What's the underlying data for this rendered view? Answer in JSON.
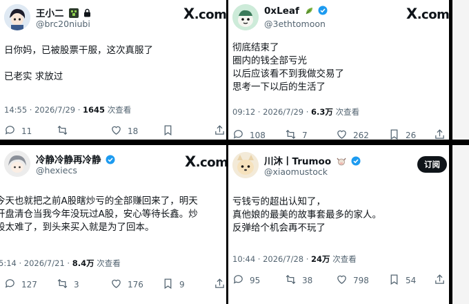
{
  "posts": [
    {
      "name": "王小二",
      "handle": "@brc20niubi",
      "brand": "X.com",
      "lines": [
        "日你妈，已被股票干服，这次真服了",
        "",
        "已老实 求放过"
      ],
      "time": "14:55 · 2026/7/29 · ",
      "views": "1645",
      "views_suffix": " 次查看",
      "replies": "11",
      "reposts": "",
      "likes": "18",
      "bookmarks": ""
    },
    {
      "name": "0xLeaf",
      "handle": "@3ethtomoon",
      "brand": "X.com",
      "lines": [
        "彻底结束了",
        "圈内的钱全部亏光",
        "以后应该看不到我做交易了",
        "思考一下以后的生活了"
      ],
      "time": "09:12 · 2026/7/29 · ",
      "views": "6.3万",
      "views_suffix": " 次查看",
      "replies": "108",
      "reposts": "7",
      "likes": "262",
      "bookmarks": "26"
    },
    {
      "name": "冷静冷静再冷静",
      "handle": "@hexiecs",
      "brand": "X.com",
      "lines": [
        "今天也就把之前A股瞎炒亏的全部赚回来了，明天",
        "开盘清仓当我今年没玩过A股，安心等待长鑫。炒",
        "股太难了，到头来买入就是为了回本。"
      ],
      "time": "5:14 · 2026/7/21 · ",
      "views": "8.4万",
      "views_suffix": " 次查看",
      "replies": "127",
      "reposts": "3",
      "likes": "176",
      "bookmarks": "9"
    },
    {
      "name": "川沐丨Trumoo",
      "handle": "@xiaomustock",
      "follow": "订阅",
      "lines": [
        "亏钱亏的超出认知了，",
        "真他娘的最美的故事套最多的家人。",
        "反弹给个机会再不玩了"
      ],
      "time": "10:44 · 2026/7/28 · ",
      "views": "24万",
      "views_suffix": " 次查看",
      "replies": "95",
      "reposts": "38",
      "likes": "798",
      "bookmarks": "54"
    }
  ]
}
